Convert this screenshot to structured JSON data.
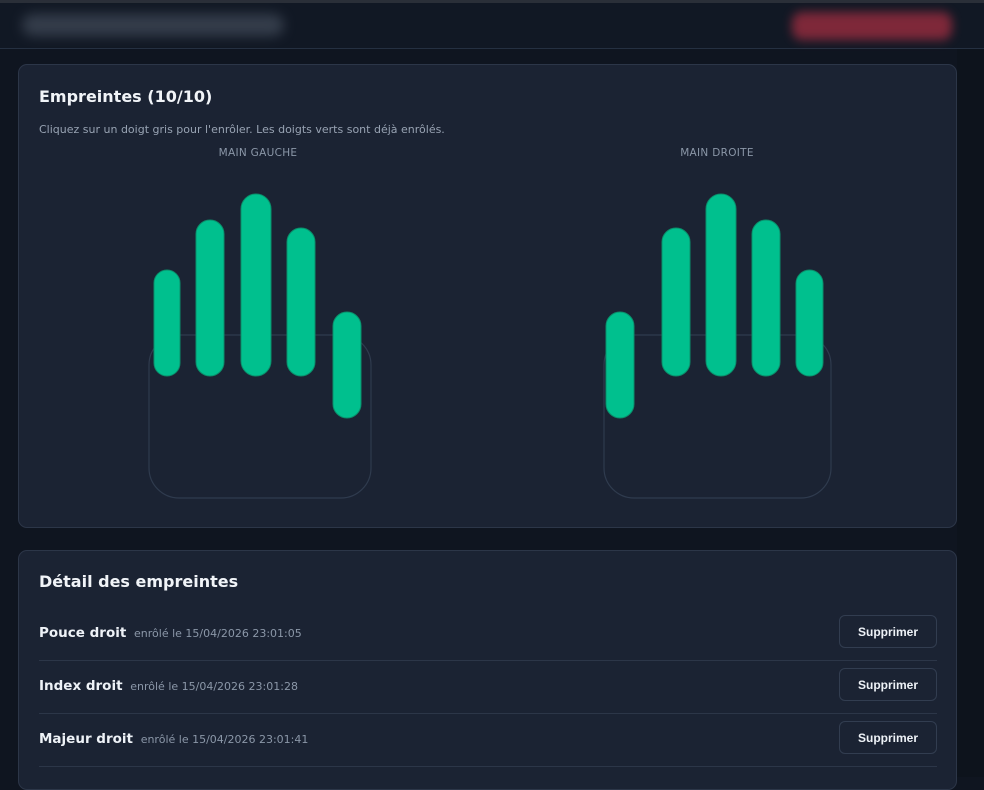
{
  "header": {
    "title": "",
    "action_label": ""
  },
  "fingerprints_card": {
    "title": "Empreintes (10/10)",
    "hint": "Cliquez sur un doigt gris pour l'enrôler. Les doigts verts sont déjà enrôlés.",
    "left_hand_label": "MAIN GAUCHE",
    "right_hand_label": "MAIN DROITE",
    "enrolled_color": "#00c08e",
    "left_hand_fingers": [
      {
        "finger": "auriculaire",
        "enrolled": true
      },
      {
        "finger": "annulaire",
        "enrolled": true
      },
      {
        "finger": "majeur",
        "enrolled": true
      },
      {
        "finger": "index",
        "enrolled": true
      },
      {
        "finger": "pouce",
        "enrolled": true
      }
    ],
    "right_hand_fingers": [
      {
        "finger": "pouce",
        "enrolled": true
      },
      {
        "finger": "index",
        "enrolled": true
      },
      {
        "finger": "majeur",
        "enrolled": true
      },
      {
        "finger": "annulaire",
        "enrolled": true
      },
      {
        "finger": "auriculaire",
        "enrolled": true
      }
    ]
  },
  "details_card": {
    "title": "Détail des empreintes",
    "rows": [
      {
        "name": "Pouce droit",
        "meta": "enrôlé le 15/04/2026 23:01:05",
        "button": "Supprimer"
      },
      {
        "name": "Index droit",
        "meta": "enrôlé le 15/04/2026 23:01:28",
        "button": "Supprimer"
      },
      {
        "name": "Majeur droit",
        "meta": "enrôlé le 15/04/2026 23:01:41",
        "button": "Supprimer"
      }
    ]
  }
}
